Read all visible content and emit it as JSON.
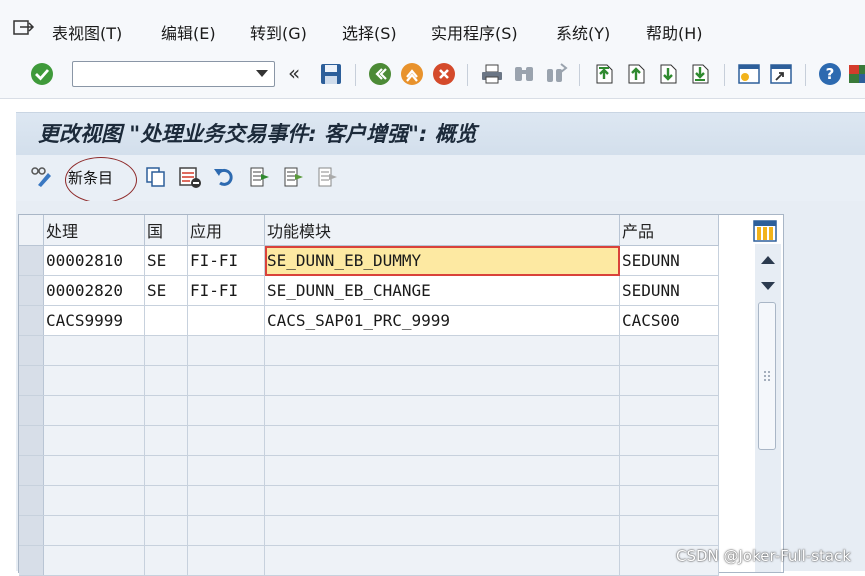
{
  "menu": {
    "items": [
      {
        "label": "表视图(T)"
      },
      {
        "label": "编辑(E)"
      },
      {
        "label": "转到(G)"
      },
      {
        "label": "选择(S)"
      },
      {
        "label": "实用程序(S)"
      },
      {
        "label": "系统(Y)"
      },
      {
        "label": "帮助(H)"
      }
    ]
  },
  "toolbar": {
    "command_field_value": "",
    "back_symbol": "«",
    "icons": [
      "confirm-icon",
      "save-icon",
      "back-icon",
      "exit-icon",
      "cancel-icon",
      "print-icon",
      "find-icon",
      "find-next-icon",
      "first-page-icon",
      "previous-page-icon",
      "next-page-icon",
      "last-page-icon",
      "new-session-icon",
      "shortcut-icon",
      "help-icon",
      "layout-icon"
    ]
  },
  "title": "更改视图 \"处理业务交易事件: 客户增强\": 概览",
  "app_toolbar": {
    "new_entries_label": "新条目"
  },
  "table": {
    "columns": [
      "处理",
      "国",
      "应用",
      "功能模块",
      "产品"
    ],
    "rows": [
      [
        "00002810",
        "SE",
        "FI-FI",
        "SE_DUNN_EB_DUMMY",
        "SEDUNN"
      ],
      [
        "00002820",
        "SE",
        "FI-FI",
        "SE_DUNN_EB_CHANGE",
        "SEDUNN"
      ],
      [
        "CACS9999",
        "",
        "",
        "CACS_SAP01_PRC_9999",
        "CACS00"
      ]
    ],
    "empty_rows": 8,
    "focused_cell": {
      "row": 0,
      "col": 3
    }
  },
  "watermark": "CSDN @Joker-Full-stack",
  "colors": {
    "title_bar": "#d3dfec",
    "focus_cell": "#fde9a2",
    "focus_border": "#d9423a",
    "annotation_circle": "#8e2a2a"
  }
}
